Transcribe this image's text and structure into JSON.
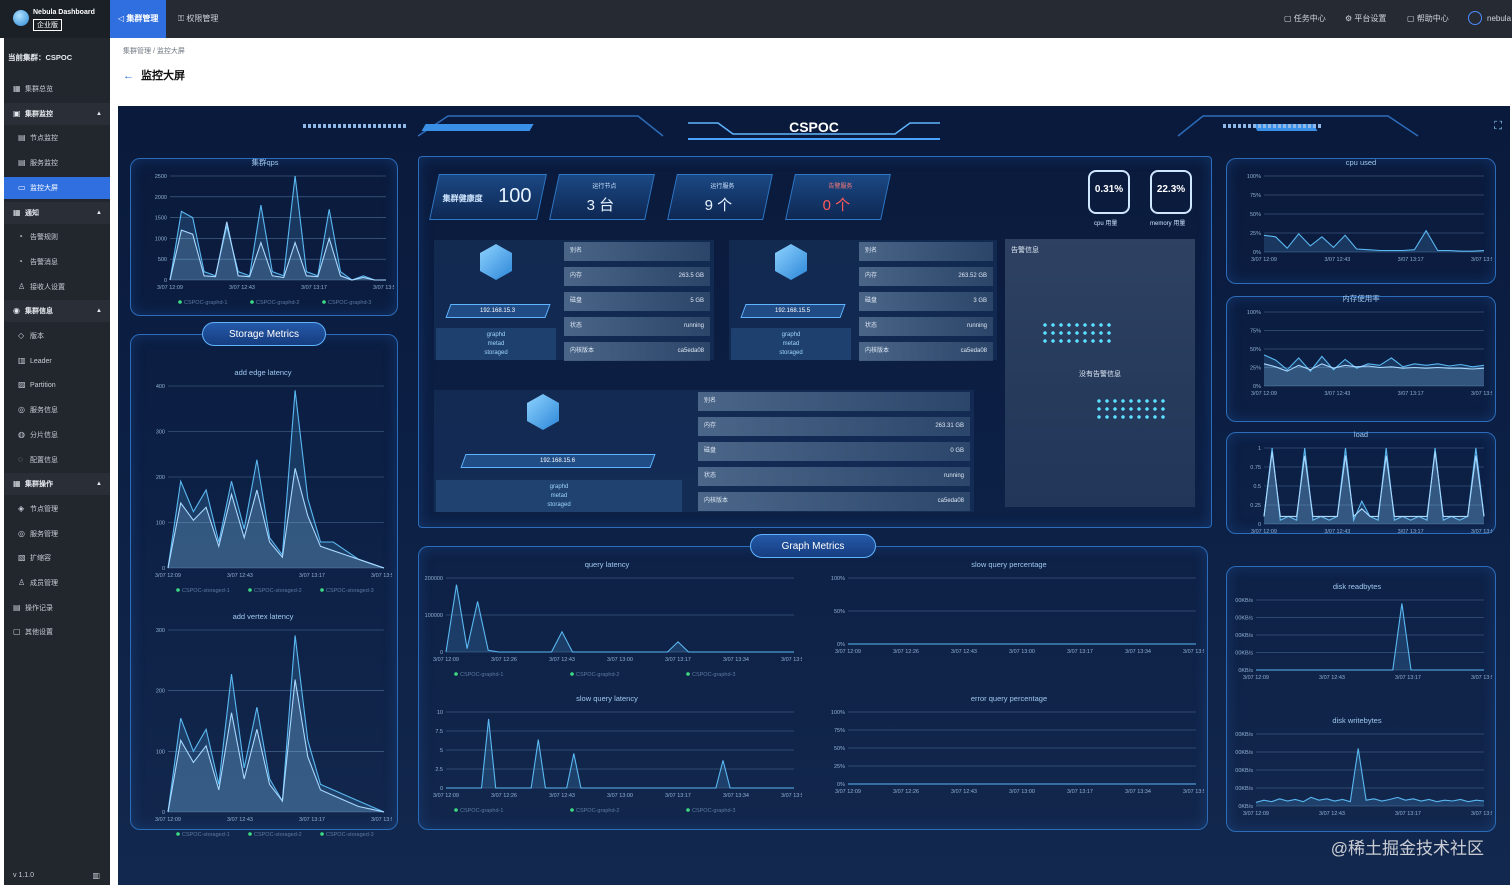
{
  "app": {
    "name": "Nebula Dashboard",
    "edition": "企业版"
  },
  "topnav": {
    "tabs": [
      {
        "label": "集群管理"
      },
      {
        "label": "权限管理"
      }
    ],
    "right": [
      {
        "label": "任务中心"
      },
      {
        "label": "平台设置"
      },
      {
        "label": "帮助中心"
      }
    ],
    "user": "nebula"
  },
  "sidebar": {
    "current_cluster": "当前集群：CSPOC",
    "items": [
      {
        "label": "集群总览",
        "kind": "item",
        "icon": "grid-icon"
      },
      {
        "label": "集群监控",
        "kind": "group",
        "icon": "monitor-icon"
      },
      {
        "label": "节点监控",
        "kind": "sub",
        "icon": "chart-icon"
      },
      {
        "label": "服务监控",
        "kind": "sub",
        "icon": "chart-icon"
      },
      {
        "label": "监控大屏",
        "kind": "sub",
        "active": true,
        "icon": "screen-icon"
      },
      {
        "label": "通知",
        "kind": "group",
        "icon": "bell-icon"
      },
      {
        "label": "告警规则",
        "kind": "sub",
        "icon": "alarm-icon"
      },
      {
        "label": "告警消息",
        "kind": "sub",
        "icon": "alarm-icon"
      },
      {
        "label": "接收人设置",
        "kind": "sub",
        "icon": "people-icon"
      },
      {
        "label": "集群信息",
        "kind": "group",
        "icon": "info-icon"
      },
      {
        "label": "版本",
        "kind": "sub",
        "icon": "tag-icon"
      },
      {
        "label": "Leader",
        "kind": "sub",
        "icon": "leader-icon"
      },
      {
        "label": "Partition",
        "kind": "sub",
        "icon": "partition-icon"
      },
      {
        "label": "服务信息",
        "kind": "sub",
        "icon": "service-icon"
      },
      {
        "label": "分片信息",
        "kind": "sub",
        "icon": "shard-icon"
      },
      {
        "label": "配置信息",
        "kind": "sub",
        "icon": "config-icon"
      },
      {
        "label": "集群操作",
        "kind": "group",
        "icon": "ops-icon"
      },
      {
        "label": "节点管理",
        "kind": "sub",
        "icon": "node-icon"
      },
      {
        "label": "服务管理",
        "kind": "sub",
        "icon": "service-icon"
      },
      {
        "label": "扩缩容",
        "kind": "sub",
        "icon": "scale-icon"
      },
      {
        "label": "成员管理",
        "kind": "sub",
        "icon": "member-icon"
      },
      {
        "label": "操作记录",
        "kind": "item",
        "icon": "record-icon"
      },
      {
        "label": "其他设置",
        "kind": "item",
        "icon": "settings-icon"
      }
    ],
    "version": "v 1.1.0"
  },
  "breadcrumb": "集群管理 / 监控大屏",
  "page_title": "监控大屏",
  "dashboard": {
    "title": "CSPOC",
    "stats": [
      {
        "label": "集群健康度",
        "value": "100"
      },
      {
        "label": "运行节点",
        "value": "3 台"
      },
      {
        "label": "运行服务",
        "value": "9 个"
      },
      {
        "label": "告警服务",
        "value": "0 个",
        "color": "#ff5a5a"
      }
    ],
    "rings": [
      {
        "value": "0.31%",
        "label": "cpu 用量"
      },
      {
        "value": "22.3%",
        "label": "memory 用量"
      }
    ],
    "nodes": [
      {
        "ip": "192.168.15.3",
        "services": [
          "graphd",
          "metad",
          "storaged"
        ],
        "info": [
          [
            "别名",
            ""
          ],
          [
            "内存",
            "263.5 GB"
          ],
          [
            "磁盘",
            "5 GB"
          ],
          [
            "状态",
            "running"
          ],
          [
            "内核版本",
            "ca5eda08"
          ]
        ]
      },
      {
        "ip": "192.168.15.5",
        "services": [
          "graphd",
          "metad",
          "storaged"
        ],
        "info": [
          [
            "别名",
            ""
          ],
          [
            "内存",
            "263.52 GB"
          ],
          [
            "磁盘",
            "3 GB"
          ],
          [
            "状态",
            "running"
          ],
          [
            "内核版本",
            "ca5eda08"
          ]
        ]
      },
      {
        "ip": "192.168.15.6",
        "services": [
          "graphd",
          "metad",
          "storaged"
        ],
        "info": [
          [
            "别名",
            ""
          ],
          [
            "内存",
            "263.31 GB"
          ],
          [
            "磁盘",
            "0 GB"
          ],
          [
            "状态",
            "running"
          ],
          [
            "内核版本",
            "ca5eda08"
          ]
        ]
      }
    ],
    "alerts": {
      "title": "告警信息",
      "empty": "没有告警信息"
    },
    "storage_tag": "Storage Metrics",
    "graph_tag": "Graph Metrics",
    "watermark": "@稀土掘金技术社区"
  },
  "charts": [
    {
      "name": "graph-qps-chart",
      "title": "集群qps",
      "type": "line",
      "yticks": [
        "2500",
        "2000",
        "1500",
        "1000",
        "500",
        "0"
      ],
      "ymax": 2500,
      "xticks": [
        "3/07 12:09",
        "3/07 12:43",
        "3/07 13:17",
        "3/07 13:51"
      ],
      "legend": [
        "CSPOC-graphd-1",
        "CSPOC-graphd-2",
        "CSPOC-graphd-3"
      ],
      "series": [
        [
          0,
          1650,
          1500,
          200,
          100,
          1300,
          200,
          100,
          1800,
          200,
          100,
          2500,
          200,
          100,
          1700,
          200,
          0,
          100,
          0,
          0
        ],
        [
          0,
          1200,
          1100,
          100,
          80,
          1400,
          100,
          80,
          900,
          100,
          60,
          900,
          100,
          80,
          1000,
          100,
          0,
          60,
          0,
          0
        ]
      ]
    },
    {
      "name": "add-edge-latency-chart",
      "title": "add edge latency",
      "type": "line",
      "yticks": [
        "400",
        "300",
        "200",
        "100",
        "0"
      ],
      "ymax": 420,
      "xticks": [
        "3/07 12:09",
        "3/07 12:43",
        "3/07 13:17",
        "3/07 13:51"
      ],
      "legend": [
        "CSPOC-storaged-1",
        "CSPOC-storaged-2",
        "CSPOC-storaged-3"
      ],
      "series": [
        [
          0,
          200,
          130,
          180,
          60,
          200,
          90,
          250,
          70,
          30,
          410,
          160,
          60,
          60,
          40,
          20,
          10,
          0
        ],
        [
          0,
          150,
          110,
          140,
          50,
          170,
          70,
          180,
          60,
          25,
          230,
          120,
          50,
          40,
          30,
          20,
          10,
          0
        ]
      ]
    },
    {
      "name": "add-vertex-latency-chart",
      "title": "add vertex latency",
      "type": "line",
      "yticks": [
        "300",
        "200",
        "100",
        "0"
      ],
      "ymax": 330,
      "xticks": [
        "3/07 12:09",
        "3/07 12:43",
        "3/07 13:17",
        "3/07 13:51"
      ],
      "legend": [
        "CSPOC-storaged-1",
        "CSPOC-storaged-2",
        "CSPOC-storaged-3"
      ],
      "series": [
        [
          0,
          170,
          110,
          150,
          50,
          250,
          80,
          190,
          60,
          20,
          320,
          130,
          50,
          40,
          30,
          20,
          10,
          0
        ],
        [
          0,
          130,
          90,
          120,
          40,
          180,
          60,
          150,
          50,
          20,
          240,
          100,
          40,
          30,
          20,
          10,
          5,
          0
        ]
      ]
    },
    {
      "name": "query-latency-chart",
      "title": "query latency",
      "type": "line",
      "yticks": [
        "200000",
        "100000",
        "0"
      ],
      "ymax": 220000,
      "xticks": [
        "3/07 12:09",
        "3/07 12:26",
        "3/07 12:43",
        "3/07 13:00",
        "3/07 13:17",
        "3/07 13:34",
        "3/07 13:51"
      ],
      "legend": [
        "CSPOC-graphd-1",
        "CSPOC-graphd-2",
        "CSPOC-graphd-3"
      ],
      "series": [
        [
          0,
          200000,
          10000,
          150000,
          5000,
          0,
          0,
          0,
          0,
          0,
          0,
          60000,
          0,
          0,
          0,
          0,
          0,
          0,
          0,
          0,
          0,
          0,
          30000,
          0,
          0,
          0,
          0,
          0,
          0,
          0,
          0,
          0,
          0,
          0
        ]
      ]
    },
    {
      "name": "slow-query-percentage-chart",
      "title": "slow query percentage",
      "type": "line",
      "yticks": [
        "100%",
        "50%",
        "0%"
      ],
      "ymax": 100,
      "xticks": [
        "3/07 12:09",
        "3/07 12:26",
        "3/07 12:43",
        "3/07 13:00",
        "3/07 13:17",
        "3/07 13:34",
        "3/07 13:51"
      ],
      "legend": [],
      "series": [
        [
          0,
          0,
          0,
          0,
          0,
          0,
          0,
          0,
          0,
          0
        ]
      ]
    },
    {
      "name": "slow-query-latency-chart",
      "title": "slow query latency",
      "type": "line",
      "yticks": [
        "10",
        "7.5",
        "5",
        "2.5",
        "0"
      ],
      "ymax": 11,
      "xticks": [
        "3/07 12:09",
        "3/07 12:26",
        "3/07 12:43",
        "3/07 13:00",
        "3/07 13:17",
        "3/07 13:34",
        "3/07 13:51"
      ],
      "legend": [
        "CSPOC-graphd-1",
        "CSPOC-graphd-2",
        "CSPOC-graphd-3"
      ],
      "series": [
        [
          0,
          0,
          0,
          0,
          0,
          0,
          10,
          0,
          0,
          0,
          0,
          0,
          0,
          7,
          0,
          0,
          0,
          0,
          5,
          0,
          0,
          0,
          0,
          0,
          0,
          0,
          0,
          0,
          0,
          0,
          0,
          0,
          0,
          0,
          0,
          0,
          0,
          0,
          0,
          4,
          0,
          0,
          0,
          0,
          0,
          0,
          0,
          0,
          0,
          0
        ]
      ]
    },
    {
      "name": "error-query-percentage-chart",
      "title": "error query percentage",
      "type": "line",
      "yticks": [
        "100%",
        "75%",
        "50%",
        "25%",
        "0%"
      ],
      "ymax": 100,
      "xticks": [
        "3/07 12:09",
        "3/07 12:26",
        "3/07 12:43",
        "3/07 13:00",
        "3/07 13:17",
        "3/07 13:34",
        "3/07 13:51"
      ],
      "legend": [],
      "series": [
        [
          0,
          0,
          0,
          0,
          0,
          0,
          0,
          0,
          0,
          0
        ]
      ]
    },
    {
      "name": "cpu-used-chart",
      "title": "cpu used",
      "type": "line",
      "yticks": [
        "100%",
        "75%",
        "50%",
        "25%",
        "0%"
      ],
      "ymax": 100,
      "xticks": [
        "3/07 12:09",
        "3/07 12:43",
        "3/07 13:17",
        "3/07 13:51"
      ],
      "legend": [],
      "series": [
        [
          22,
          20,
          5,
          24,
          8,
          20,
          6,
          22,
          4,
          3,
          2,
          2,
          2,
          3,
          28,
          2,
          2,
          1,
          1,
          2
        ]
      ]
    },
    {
      "name": "memory-usage-chart",
      "title": "内存使用率",
      "type": "line",
      "yticks": [
        "100%",
        "75%",
        "50%",
        "25%",
        "0%"
      ],
      "ymax": 100,
      "xticks": [
        "3/07 12:09",
        "3/07 12:43",
        "3/07 13:17",
        "3/07 13:51"
      ],
      "legend": [],
      "series": [
        [
          42,
          35,
          22,
          38,
          20,
          40,
          22,
          36,
          24,
          30,
          28,
          38,
          26,
          30,
          28,
          30,
          27,
          29,
          26,
          28
        ],
        [
          30,
          26,
          20,
          28,
          22,
          30,
          24,
          28,
          26,
          27,
          25,
          26,
          24,
          25,
          24,
          25,
          24,
          24,
          23,
          24
        ]
      ]
    },
    {
      "name": "load-chart",
      "title": "load",
      "type": "line",
      "yticks": [
        "1",
        "0.75",
        "0.5",
        "0.25",
        "0"
      ],
      "ymax": 1,
      "xticks": [
        "3/07 12:09",
        "3/07 12:43",
        "3/07 13:17",
        "3/07 13:51"
      ],
      "legend": [],
      "series": [
        [
          0.1,
          1,
          0.05,
          0.1,
          0.05,
          1,
          0.05,
          0.1,
          0.05,
          0.1,
          1,
          0.05,
          0.3,
          0.1,
          0.05,
          1,
          0.05,
          0.1,
          0.05,
          0.1,
          0.05,
          1,
          0.05,
          0.1,
          0.05,
          0.1,
          1,
          0.1
        ],
        [
          0.1,
          0.95,
          0.1,
          0.1,
          0.1,
          0.9,
          0.1,
          0.1,
          0.1,
          0.1,
          0.9,
          0.1,
          0.2,
          0.1,
          0.1,
          0.9,
          0.1,
          0.1,
          0.1,
          0.1,
          0.1,
          0.95,
          0.1,
          0.1,
          0.1,
          0.1,
          0.9,
          0.1
        ]
      ]
    },
    {
      "name": "disk-readbytes-chart",
      "title": "disk readbytes",
      "type": "line",
      "yticks": [
        "00KB/s",
        "00KB/s",
        "00KB/s",
        "00KB/s",
        "0KB/s"
      ],
      "ymax": 100,
      "xticks": [
        "3/07 12:09",
        "3/07 12:43",
        "3/07 13:17",
        "3/07 13:51"
      ],
      "legend": [],
      "series": [
        [
          0,
          0,
          0,
          0,
          0,
          0,
          0,
          0,
          0,
          0,
          0,
          0,
          0,
          0,
          0,
          0,
          95,
          0,
          0,
          0,
          0,
          0,
          0,
          0,
          0,
          0
        ]
      ]
    },
    {
      "name": "disk-writebytes-chart",
      "title": "disk writebytes",
      "type": "line",
      "yticks": [
        "00KB/s",
        "00KB/s",
        "00KB/s",
        "00KB/s",
        "0KB/s"
      ],
      "ymax": 100,
      "xticks": [
        "3/07 12:09",
        "3/07 12:43",
        "3/07 13:17",
        "3/07 13:51"
      ],
      "legend": [],
      "series": [
        [
          5,
          8,
          6,
          10,
          7,
          9,
          6,
          12,
          8,
          10,
          7,
          9,
          6,
          80,
          8,
          10,
          7,
          9,
          12,
          8,
          10,
          7,
          9,
          6,
          8,
          7,
          9,
          6,
          8,
          7
        ]
      ]
    }
  ]
}
